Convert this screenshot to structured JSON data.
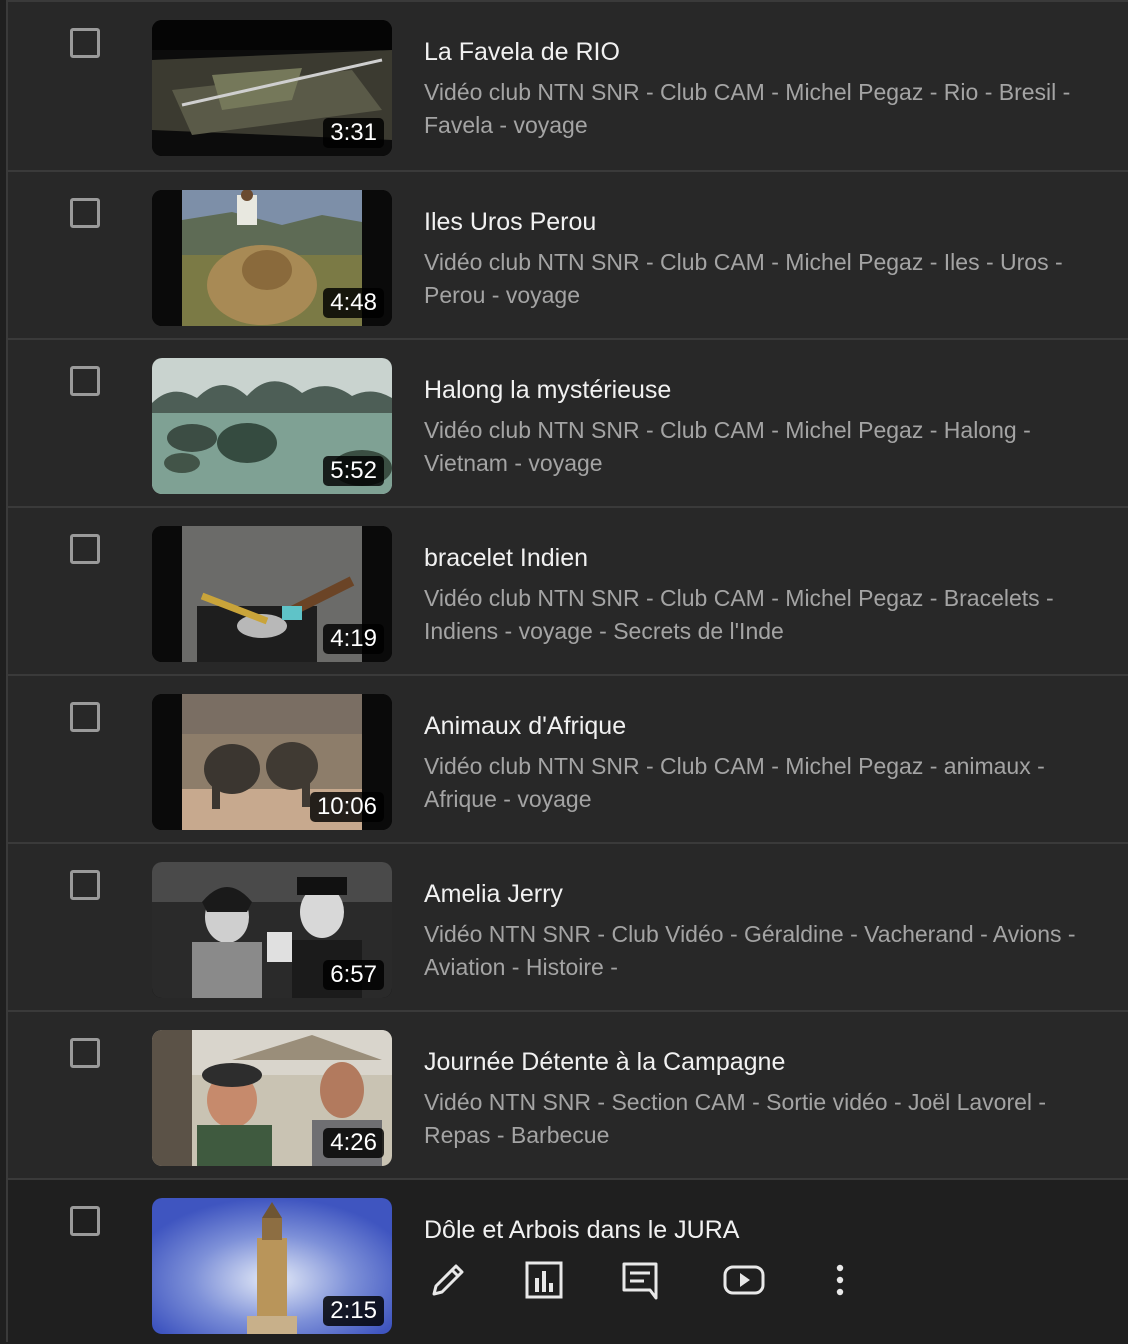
{
  "videos": [
    {
      "title": "La Favela de RIO",
      "description": "Vidéo club NTN SNR - Club CAM - Michel Pegaz - Rio - Bresil - Favela - voyage",
      "duration": "3:31"
    },
    {
      "title": "Iles Uros Perou",
      "description": "Vidéo club NTN SNR - Club CAM - Michel Pegaz - Iles - Uros - Perou - voyage",
      "duration": "4:48"
    },
    {
      "title": "Halong la mystérieuse",
      "description": "Vidéo club NTN SNR - Club CAM - Michel Pegaz - Halong - Vietnam - voyage",
      "duration": "5:52"
    },
    {
      "title": "bracelet Indien",
      "description": "Vidéo club NTN SNR - Club CAM - Michel Pegaz - Bracelets - Indiens - voyage - Secrets de l'Inde",
      "duration": "4:19"
    },
    {
      "title": "Animaux d'Afrique",
      "description": "Vidéo club NTN SNR - Club CAM - Michel Pegaz - animaux - Afrique - voyage",
      "duration": "10:06"
    },
    {
      "title": "Amelia Jerry",
      "description": "Vidéo NTN SNR - Club Vidéo - Géraldine - Vacherand - Avions - Aviation - Histoire -",
      "duration": "6:57"
    },
    {
      "title": "Journée Détente à la Campagne",
      "description": "Vidéo NTN SNR - Section CAM - Sortie vidéo - Joël Lavorel - Repas - Barbecue",
      "duration": "4:26"
    },
    {
      "title": "Dôle et Arbois dans le JURA",
      "description": "",
      "duration": "2:15"
    }
  ],
  "hover_actions": [
    "pencil-icon",
    "analytics-icon",
    "comments-icon",
    "youtube-icon",
    "more-vert-icon"
  ]
}
